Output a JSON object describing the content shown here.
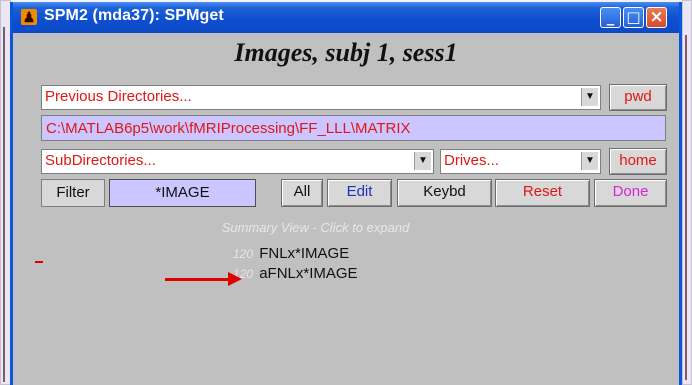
{
  "window": {
    "title": "SPM2 (mda37): SPMget",
    "app_icon": "matlab-icon",
    "controls": {
      "minimize": "minimize-icon",
      "maximize": "maximize-icon",
      "close": "close-icon"
    }
  },
  "dialog": {
    "title": "Images, subj 1, sess1",
    "previous_directories": {
      "value": "Previous Directories...",
      "arrow": "▼"
    },
    "pwd_button": "pwd",
    "current_path": "C:\\MATLAB6p5\\work\\fMRIProcessing\\FF_LLL\\MATRIX",
    "subdirectories": {
      "value": "SubDirectories...",
      "arrow": "▼"
    },
    "drives": {
      "value": "Drives...",
      "arrow": "▼"
    },
    "home_button": "home",
    "filter_label": "Filter",
    "filter_value": "*IMAGE",
    "buttons": {
      "all": "All",
      "edit": "Edit",
      "keybd": "Keybd",
      "reset": "Reset",
      "done": "Done"
    },
    "summary": {
      "header": "Summary View - Click to expand",
      "items": [
        {
          "count": "120",
          "label": "FNLx*IMAGE"
        },
        {
          "count": "120",
          "label": "aFNLx*IMAGE"
        }
      ]
    }
  },
  "colors": {
    "title_bar": "#0d4ac6",
    "window_bg": "#c0c0c0",
    "path_bg": "#cbc6ff",
    "red_text": "#e11616",
    "blue_text": "#1d31b8",
    "pink_text": "#d426d6",
    "annotation_red": "#e00000"
  }
}
